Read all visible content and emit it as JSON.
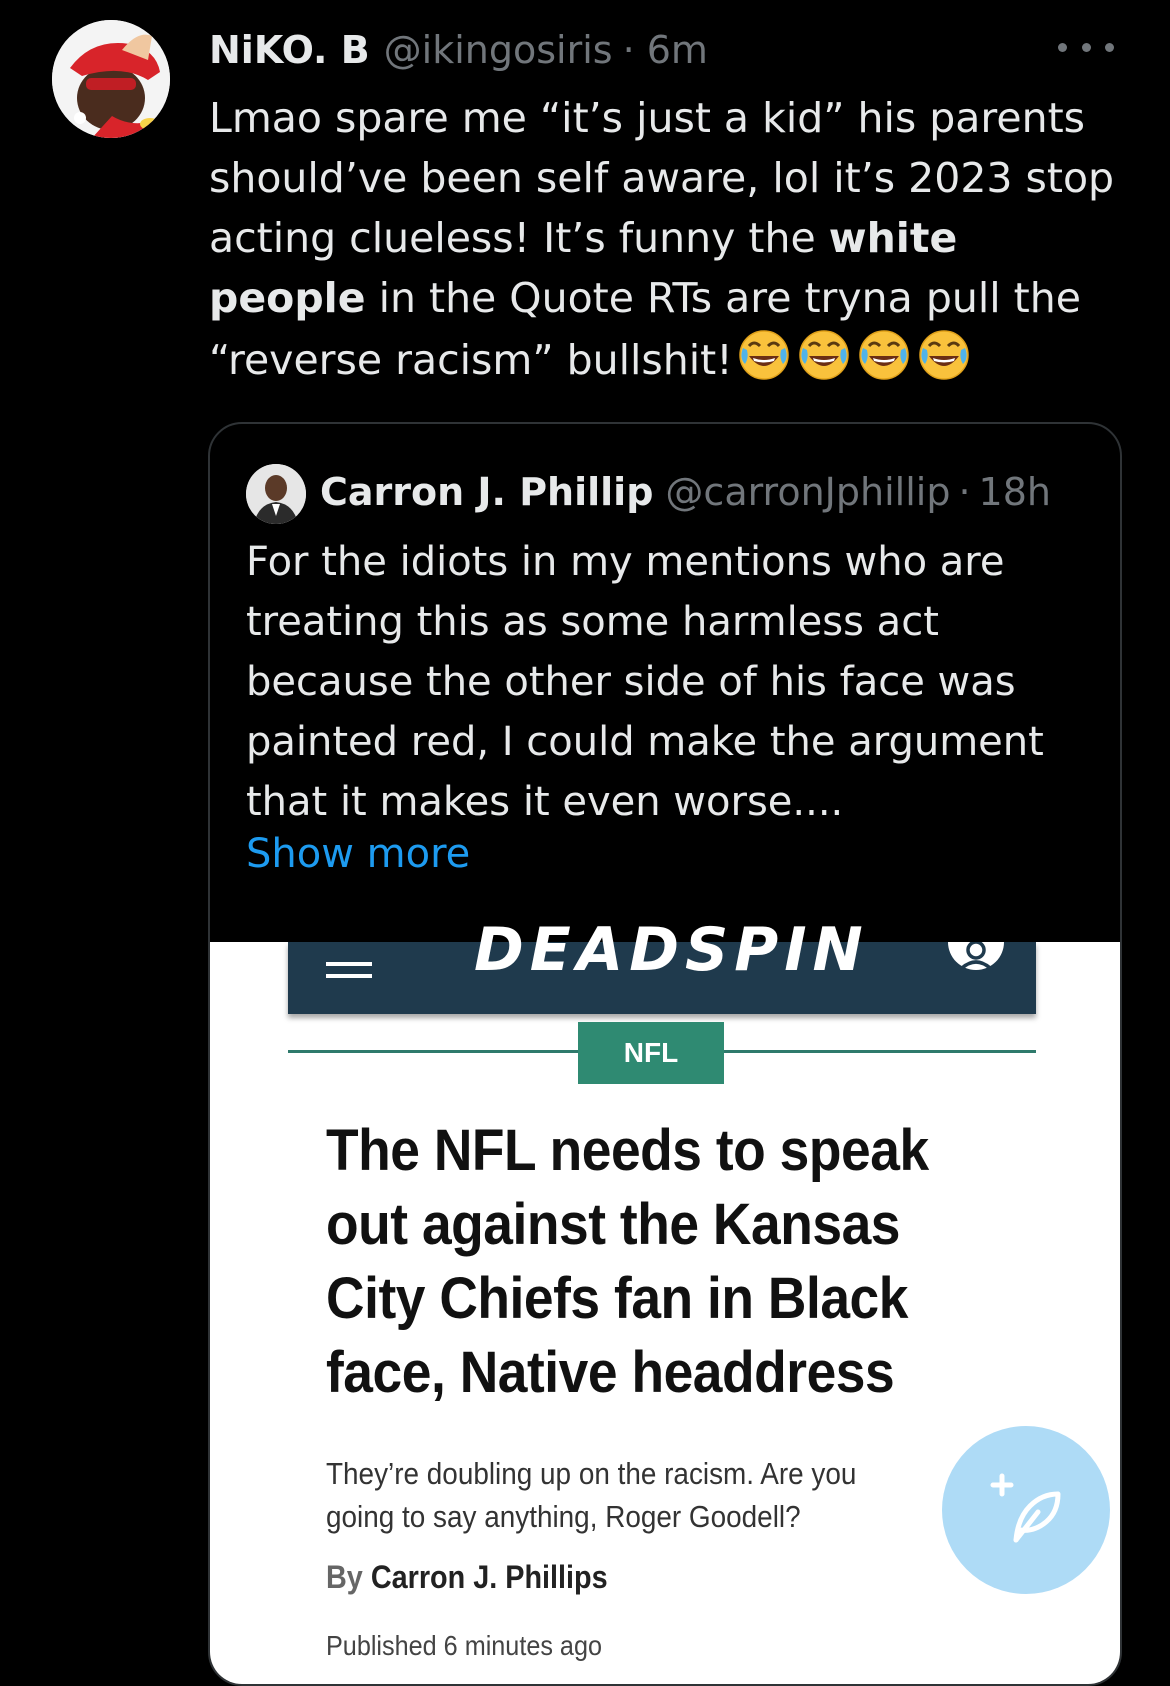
{
  "tweet": {
    "display_name": "NiKO. B",
    "handle": "@ikingosiris",
    "separator": "·",
    "time": "6m",
    "text_before_bold": "Lmao spare me “it’s just a kid” his parents should’ve been self aware, lol it’s 2023 stop acting clueless! It’s funny the ",
    "text_bold": "white people",
    "text_after_bold": " in the Quote RTs are tryna pull the “reverse racism” bullshit!",
    "emoji_count": 4,
    "emoji_name": "face-with-tears-of-joy"
  },
  "quoted_tweet": {
    "display_name": "Carron J. Phillip",
    "handle": "@carronJphillip",
    "separator": "·",
    "time": "18h",
    "text": "For the idiots in my mentions who are treating this as some harmless act because the other side of his face was painted red, I could make the argument that it makes it even worse....",
    "show_more": "Show more"
  },
  "article": {
    "site_logo": "DEADSPIN",
    "category": "NFL",
    "headline": "The NFL needs to speak out against the Kansas City Chiefs fan in Black face, Native headdress",
    "deck": "They’re doubling up on the racism. Are you going to say anything, Roger Goodell?",
    "byline_prefix": "By",
    "byline_author": "Carron J. Phillips",
    "published": "Published 6 minutes ago"
  },
  "colors": {
    "background": "#000000",
    "text_primary": "#e7e9ea",
    "text_secondary": "#71767b",
    "link": "#1d9bf0",
    "deadspin_bar": "#1f3a4d",
    "nfl_tag": "#2f8a72",
    "compose_fab": "#a8d8f6"
  },
  "icons": {
    "more": "more-horizontal-icon",
    "compose": "compose-tweet-icon"
  }
}
